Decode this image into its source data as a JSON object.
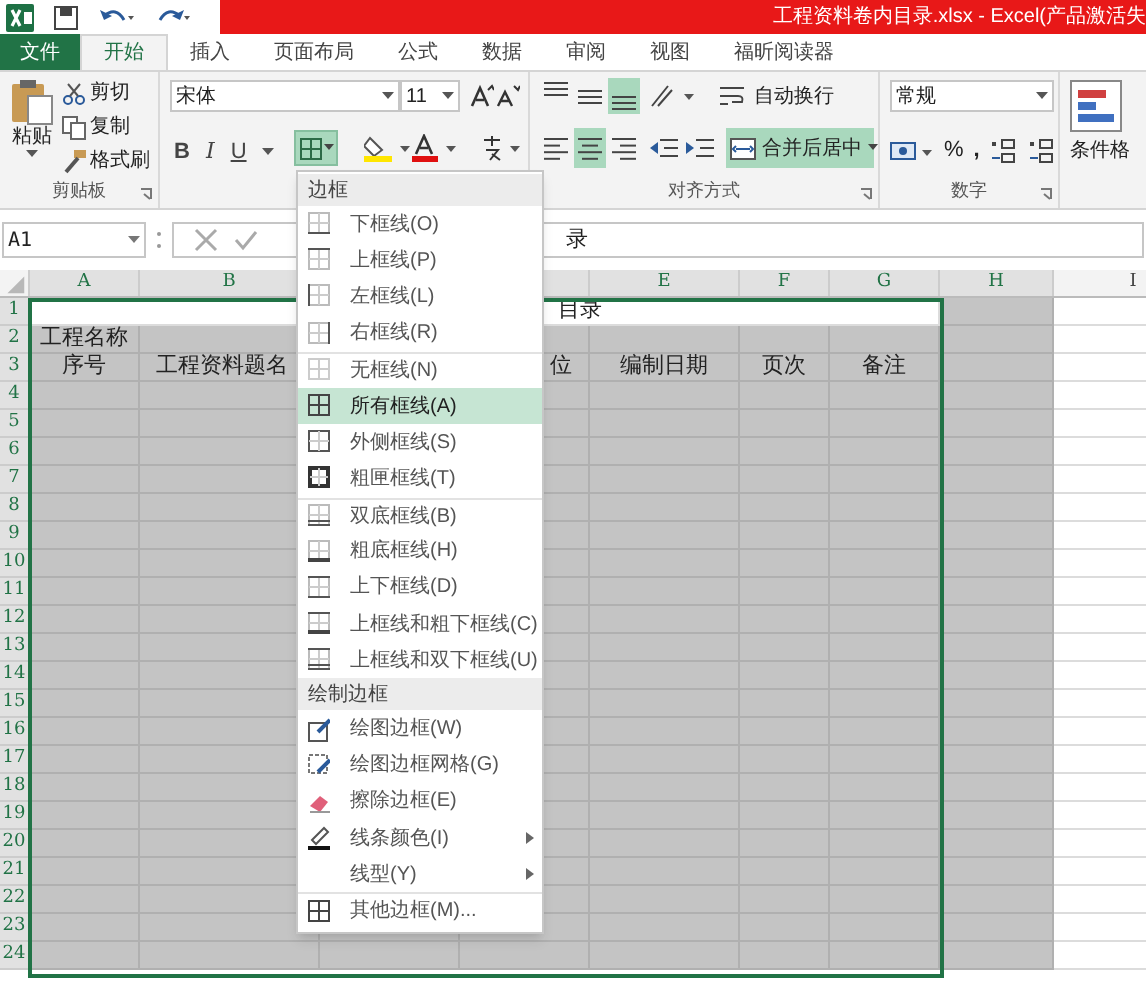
{
  "title_bar": {
    "title": "工程资料卷内目录.xlsx - Excel(产品激活失"
  },
  "tabs": [
    {
      "label": "文件",
      "kind": "file",
      "selected": false
    },
    {
      "label": "开始",
      "kind": "tab",
      "selected": true
    },
    {
      "label": "插入",
      "kind": "tab",
      "selected": false
    },
    {
      "label": "页面布局",
      "kind": "tab",
      "selected": false
    },
    {
      "label": "公式",
      "kind": "tab",
      "selected": false
    },
    {
      "label": "数据",
      "kind": "tab",
      "selected": false
    },
    {
      "label": "审阅",
      "kind": "tab",
      "selected": false
    },
    {
      "label": "视图",
      "kind": "tab",
      "selected": false
    },
    {
      "label": "福昕阅读器",
      "kind": "tab",
      "selected": false
    }
  ],
  "ribbon": {
    "clipboard": {
      "paste": "粘贴",
      "cut": "剪切",
      "copy": "复制",
      "format_painter": "格式刷",
      "label": "剪贴板"
    },
    "font": {
      "name": "宋体",
      "size": "11",
      "bold": "B",
      "italic": "I",
      "underline": "U",
      "borders_open": true
    },
    "alignment": {
      "vertical": [
        {
          "selected": false
        },
        {
          "selected": false
        },
        {
          "selected": true
        }
      ],
      "horizontal": [
        {
          "selected": false
        },
        {
          "selected": true
        },
        {
          "selected": false
        }
      ],
      "wrap_text": "自动换行",
      "merge": "合并后居中",
      "merge_selected": true,
      "label": "对齐方式"
    },
    "number": {
      "format": "常规",
      "percent": "%",
      "comma": ",",
      "label": "数字"
    },
    "styles": {
      "conditional": "条件格"
    }
  },
  "formula_bar": {
    "name_box": "A1",
    "content": "录"
  },
  "sheet": {
    "columns": [
      "A",
      "B",
      "E",
      "F",
      "G",
      "H",
      "I"
    ],
    "rows": [
      {
        "header": "1",
        "selected": true,
        "A": {
          "text": "目录",
          "merged": true,
          "active": true
        }
      },
      {
        "header": "2",
        "selected": true,
        "A": "工程名称"
      },
      {
        "header": "3",
        "selected": true,
        "A": "序号",
        "B": "工程资料题名",
        "D": "位",
        "E": "编制日期",
        "F": "页次",
        "G": "备注"
      },
      {
        "header": "4",
        "selected": true
      },
      {
        "header": "5",
        "selected": true
      },
      {
        "header": "6",
        "selected": true
      },
      {
        "header": "7",
        "selected": true
      },
      {
        "header": "8",
        "selected": true
      },
      {
        "header": "9",
        "selected": true
      },
      {
        "header": "10",
        "selected": true
      },
      {
        "header": "11",
        "selected": true
      },
      {
        "header": "12",
        "selected": true
      },
      {
        "header": "13",
        "selected": true
      },
      {
        "header": "14",
        "selected": true
      },
      {
        "header": "15",
        "selected": true
      },
      {
        "header": "16",
        "selected": true
      },
      {
        "header": "17",
        "selected": true
      },
      {
        "header": "18",
        "selected": true
      },
      {
        "header": "19",
        "selected": true
      },
      {
        "header": "20",
        "selected": true
      },
      {
        "header": "21",
        "selected": true
      },
      {
        "header": "22",
        "selected": true
      },
      {
        "header": "23",
        "selected": true
      },
      {
        "header": "24",
        "selected": true
      }
    ]
  },
  "border_menu": [
    {
      "kind": "header",
      "label": "边框"
    },
    {
      "kind": "item",
      "label": "下框线(O)",
      "selected": false,
      "divider_before": false
    },
    {
      "kind": "item",
      "label": "上框线(P)",
      "selected": false,
      "divider_before": false
    },
    {
      "kind": "item",
      "label": "左框线(L)",
      "selected": false,
      "divider_before": false
    },
    {
      "kind": "item",
      "label": "右框线(R)",
      "selected": false,
      "divider_before": false
    },
    {
      "kind": "item",
      "label": "无框线(N)",
      "selected": false,
      "divider_before": true
    },
    {
      "kind": "item",
      "label": "所有框线(A)",
      "selected": true,
      "divider_before": false
    },
    {
      "kind": "item",
      "label": "外侧框线(S)",
      "selected": false,
      "divider_before": false
    },
    {
      "kind": "item",
      "label": "粗匣框线(T)",
      "selected": false,
      "divider_before": false
    },
    {
      "kind": "item",
      "label": "双底框线(B)",
      "selected": false,
      "divider_before": true
    },
    {
      "kind": "item",
      "label": "粗底框线(H)",
      "selected": false,
      "divider_before": false
    },
    {
      "kind": "item",
      "label": "上下框线(D)",
      "selected": false,
      "divider_before": false
    },
    {
      "kind": "item",
      "label": "上框线和粗下框线(C)",
      "selected": false,
      "divider_before": false
    },
    {
      "kind": "item",
      "label": "上框线和双下框线(U)",
      "selected": false,
      "divider_before": false
    },
    {
      "kind": "header",
      "label": "绘制边框"
    },
    {
      "kind": "item",
      "label": "绘图边框(W)",
      "selected": false,
      "divider_before": false
    },
    {
      "kind": "item",
      "label": "绘图边框网格(G)",
      "selected": false,
      "divider_before": false
    },
    {
      "kind": "item",
      "label": "擦除边框(E)",
      "selected": false,
      "divider_before": false
    },
    {
      "kind": "submenu",
      "label": "线条颜色(I)",
      "selected": false,
      "divider_before": false
    },
    {
      "kind": "submenu",
      "label": "线型(Y)",
      "selected": false,
      "divider_before": false
    },
    {
      "kind": "item",
      "label": "其他边框(M)...",
      "selected": false,
      "divider_before": true
    }
  ]
}
